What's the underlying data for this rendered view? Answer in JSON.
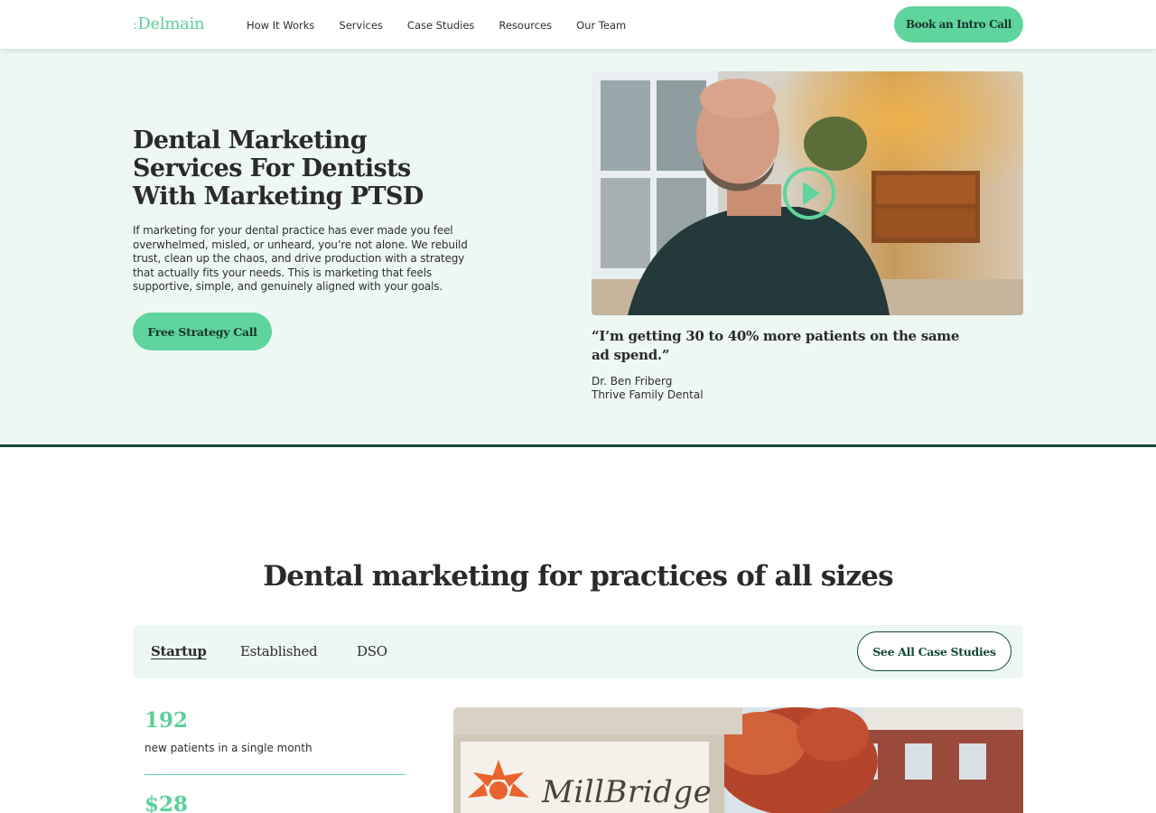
{
  "nav": {
    "logo": "Delmain",
    "logo_mark": ":",
    "links": [
      "How It Works",
      "Services",
      "Case Studies",
      "Resources",
      "Our Team"
    ],
    "cta": "Book an Intro Call"
  },
  "hero": {
    "title": "Dental Marketing Services For Dentists With Marketing PTSD",
    "body": "If marketing for your dental practice has ever made you feel overwhelmed, misled, or unheard, you’re not alone. We rebuild trust, clean up the chaos, and drive production with a strategy that actually fits your needs. This is marketing that feels supportive, simple, and genuinely aligned with your goals.",
    "cta": "Free Strategy Call",
    "quote": "“I’m getting 30 to 40% more patients on the same ad spend.”",
    "quote_name": "Dr. Ben Friberg",
    "quote_org": "Thrive Family Dental",
    "video_icon": "play-icon"
  },
  "sizes": {
    "title": "Dental marketing for practices of all sizes",
    "tabs": [
      "Startup",
      "Established",
      "DSO"
    ],
    "active_tab": "Startup",
    "cta": "See All Case Studies",
    "stats": [
      {
        "value": "192",
        "label": "new patients in a single month"
      },
      {
        "value": "$28",
        "label": ""
      }
    ],
    "sign_text": "MillBridge"
  },
  "colors": {
    "accent": "#5fd49d",
    "dark_green": "#13483b",
    "hero_bg": "#edf8f3"
  }
}
